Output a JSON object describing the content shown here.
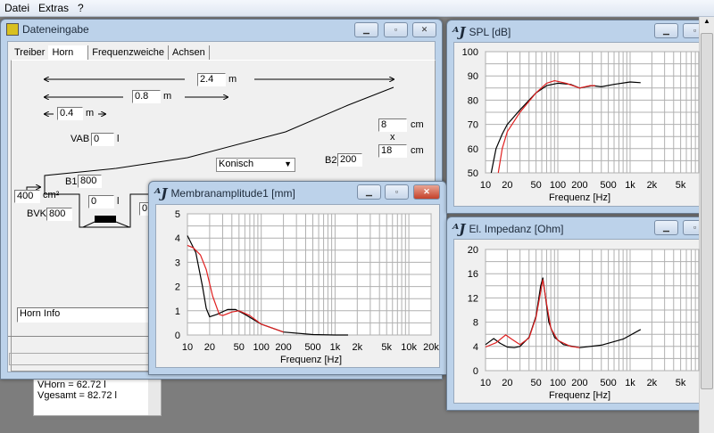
{
  "menu": [
    "Datei",
    "Extras",
    "?"
  ],
  "dateneingabe": {
    "title": "Dateneingabe",
    "tabs": [
      "Treiber",
      "Horn",
      "Frequenzweiche",
      "Achsen"
    ],
    "length_total": "2.4",
    "length_mid": "0.8",
    "length_short": "0.4",
    "unit_m": "m",
    "vab_label": "VAB",
    "vab": "0",
    "unit_l": "l",
    "mouth_w": "8",
    "mouth_h": "18",
    "unit_cm": "cm",
    "times": "x",
    "b2_label": "B2",
    "b2": "200",
    "profile": "Konisch",
    "b1_label": "B1",
    "b1": "800",
    "throat": "400",
    "unit_cm2": "cm²",
    "bvk_label": "BVK",
    "bvk": "800",
    "chamber": "0",
    "chamber2": "0",
    "horn_info": "Horn Info",
    "info_lines": [
      "VHorn = 62.72 l",
      "Vgesamt = 82.72 l"
    ]
  },
  "windows": {
    "membran": "Membranamplitude1 [mm]",
    "spl": "SPL [dB]",
    "imp": "El. Impedanz [Ohm]",
    "logo": "AJ"
  },
  "colors": {
    "series1": "#000000",
    "series2": "#e02020"
  },
  "chart_data": [
    {
      "type": "line",
      "title": "Membranamplitude1 [mm]",
      "xlabel": "Frequenz [Hz]",
      "xscale": "log",
      "xlim": [
        10,
        20000
      ],
      "ylim": [
        0,
        5
      ],
      "yticks": [
        0,
        1,
        2,
        3,
        4,
        5
      ],
      "xticks": [
        10,
        20,
        50,
        100,
        200,
        500,
        1000,
        2000,
        5000,
        10000,
        20000
      ],
      "xticklabels": [
        "10",
        "20",
        "50",
        "100",
        "200",
        "500",
        "1k",
        "2k",
        "5k",
        "10k",
        "20k"
      ],
      "series": [
        {
          "name": "black",
          "x": [
            10,
            13,
            16,
            18,
            20,
            25,
            35,
            45,
            60,
            100,
            200,
            500,
            1000,
            1500
          ],
          "y": [
            4.1,
            3.4,
            2,
            1.1,
            0.75,
            0.85,
            1.05,
            1.05,
            0.85,
            0.45,
            0.12,
            0.02,
            0,
            0
          ]
        },
        {
          "name": "red",
          "x": [
            10,
            12,
            15,
            18,
            22,
            27,
            30,
            40,
            50,
            70,
            100,
            200
          ],
          "y": [
            3.7,
            3.6,
            3.3,
            2.7,
            1.6,
            0.85,
            0.8,
            0.95,
            1,
            0.8,
            0.45,
            0.12
          ]
        }
      ]
    },
    {
      "type": "line",
      "title": "SPL [dB]",
      "xlabel": "Frequenz [Hz]",
      "xscale": "log",
      "xlim": [
        10,
        10000
      ],
      "ylim": [
        50,
        100
      ],
      "yticks": [
        50,
        60,
        70,
        80,
        90,
        100
      ],
      "xticks": [
        10,
        20,
        50,
        100,
        200,
        500,
        1000,
        2000,
        5000
      ],
      "xticklabels": [
        "10",
        "20",
        "50",
        "100",
        "200",
        "500",
        "1k",
        "2k",
        "5k"
      ],
      "series": [
        {
          "name": "black",
          "x": [
            12,
            14,
            17,
            20,
            30,
            50,
            70,
            100,
            150,
            200,
            300,
            400,
            600,
            1000,
            1400
          ],
          "y": [
            50,
            60,
            66,
            70,
            76,
            83,
            86,
            87,
            86.5,
            85,
            86,
            85.5,
            86.5,
            87.5,
            87.2
          ]
        },
        {
          "name": "red",
          "x": [
            15,
            17,
            20,
            30,
            50,
            70,
            90,
            130,
            200,
            280,
            330
          ],
          "y": [
            50,
            60,
            67,
            75,
            83,
            87,
            88,
            87,
            85,
            86,
            86
          ]
        }
      ]
    },
    {
      "type": "line",
      "title": "El. Impedanz [Ohm]",
      "xlabel": "Frequenz [Hz]",
      "xscale": "log",
      "xlim": [
        10,
        10000
      ],
      "ylim": [
        0,
        20
      ],
      "yticks": [
        0,
        4,
        8,
        12,
        16,
        20
      ],
      "xticks": [
        10,
        20,
        50,
        100,
        200,
        500,
        1000,
        2000,
        5000
      ],
      "xticklabels": [
        "10",
        "20",
        "50",
        "100",
        "200",
        "500",
        "1k",
        "2k",
        "5k"
      ],
      "series": [
        {
          "name": "black",
          "x": [
            10,
            13,
            16,
            20,
            25,
            30,
            40,
            50,
            58,
            62,
            66,
            75,
            90,
            120,
            200,
            400,
            800,
            1400
          ],
          "y": [
            4.3,
            5.3,
            4.5,
            3.9,
            3.8,
            4,
            5.5,
            9,
            14,
            15.3,
            13,
            8,
            5.5,
            4.3,
            3.8,
            4.2,
            5.2,
            6.8
          ]
        },
        {
          "name": "red",
          "x": [
            10,
            14,
            19,
            23,
            30,
            40,
            50,
            62,
            70,
            80,
            100,
            150,
            200
          ],
          "y": [
            3.9,
            4.6,
            5.9,
            5.2,
            4.3,
            5.4,
            8.8,
            15,
            11,
            7,
            5,
            4,
            3.8
          ]
        }
      ]
    }
  ]
}
